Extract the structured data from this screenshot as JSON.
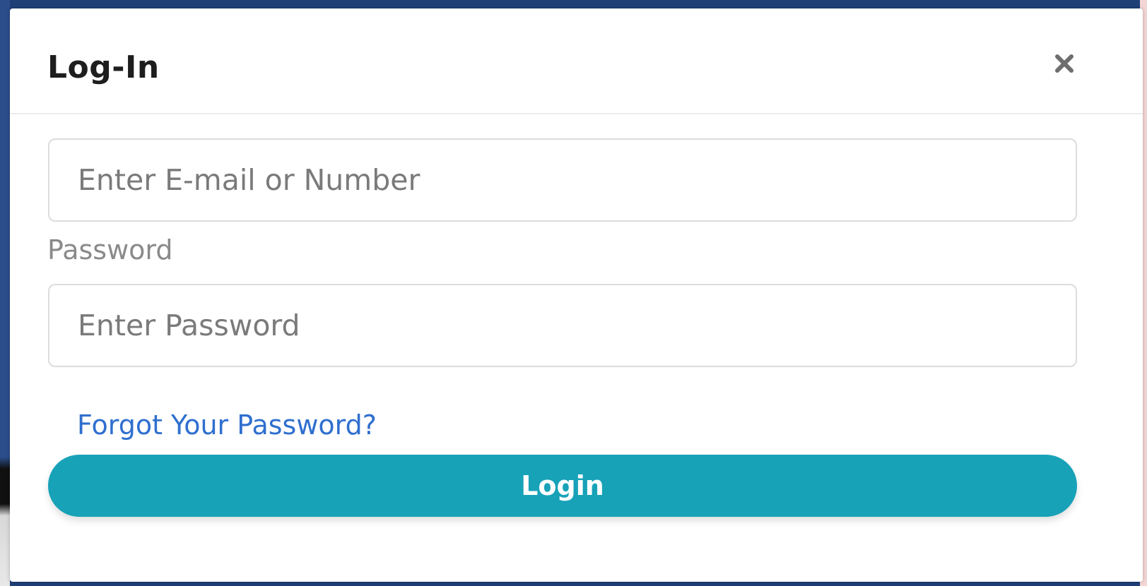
{
  "modal": {
    "title": "Log-In",
    "close_icon": "close-icon"
  },
  "form": {
    "email_placeholder": "Enter E-mail or Number",
    "email_value": "",
    "password_label": "Password",
    "password_placeholder": "Enter Password",
    "password_value": "",
    "forgot_link": "Forgot Your Password?",
    "login_button": "Login"
  },
  "colors": {
    "accent": "#17a2b8",
    "link": "#2f6fcf",
    "title": "#1e1e1e"
  }
}
